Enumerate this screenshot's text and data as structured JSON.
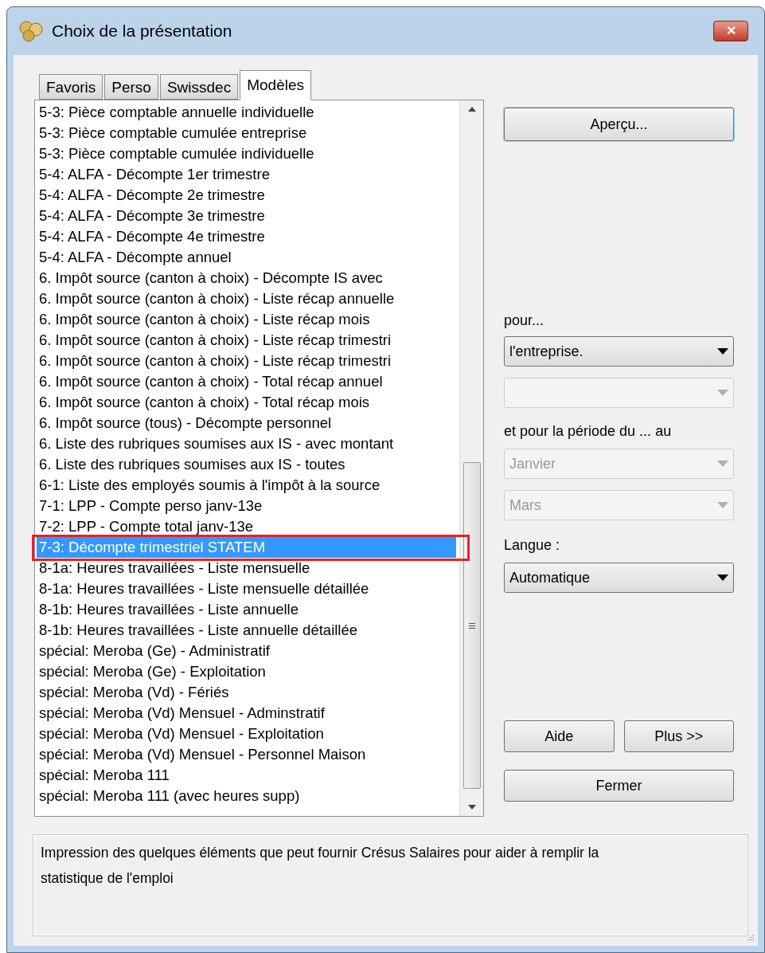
{
  "window": {
    "title": "Choix de la présentation",
    "close": "✕"
  },
  "tabs": [
    {
      "label": "Favoris",
      "selected": false
    },
    {
      "label": "Perso",
      "selected": false
    },
    {
      "label": "Swissdec",
      "selected": false
    },
    {
      "label": "Modèles",
      "selected": true
    }
  ],
  "list": {
    "items": [
      {
        "label": "5-3: Pièce comptable annuelle individuelle",
        "selected": false
      },
      {
        "label": "5-3: Pièce comptable cumulée entreprise",
        "selected": false
      },
      {
        "label": "5-3: Pièce comptable cumulée individuelle",
        "selected": false
      },
      {
        "label": "5-4: ALFA - Décompte 1er trimestre",
        "selected": false
      },
      {
        "label": "5-4: ALFA - Décompte 2e trimestre",
        "selected": false
      },
      {
        "label": "5-4: ALFA - Décompte 3e trimestre",
        "selected": false
      },
      {
        "label": "5-4: ALFA - Décompte 4e trimestre",
        "selected": false
      },
      {
        "label": "5-4: ALFA - Décompte annuel",
        "selected": false
      },
      {
        "label": "6. Impôt source (canton à choix) - Décompte IS avec",
        "selected": false
      },
      {
        "label": "6. Impôt source (canton à choix) - Liste récap annuelle",
        "selected": false
      },
      {
        "label": "6. Impôt source (canton à choix) - Liste récap mois",
        "selected": false
      },
      {
        "label": "6. Impôt source (canton à choix) - Liste récap trimestri",
        "selected": false
      },
      {
        "label": "6. Impôt source (canton à choix) - Liste récap trimestri",
        "selected": false
      },
      {
        "label": "6. Impôt source (canton à choix) - Total récap annuel",
        "selected": false
      },
      {
        "label": "6. Impôt source (canton à choix) - Total récap mois",
        "selected": false
      },
      {
        "label": "6. Impôt source (tous) - Décompte personnel",
        "selected": false
      },
      {
        "label": "6. Liste des rubriques soumises aux IS - avec montant",
        "selected": false
      },
      {
        "label": "6. Liste des rubriques soumises aux IS - toutes",
        "selected": false
      },
      {
        "label": "6-1: Liste des employés soumis à l'impôt à la source",
        "selected": false
      },
      {
        "label": "7-1: LPP - Compte perso janv-13e",
        "selected": false
      },
      {
        "label": "7-2: LPP - Compte total janv-13e",
        "selected": false
      },
      {
        "label": "7-3: Décompte trimestriel STATEM",
        "selected": true
      },
      {
        "label": "8-1a: Heures travaillées - Liste mensuelle",
        "selected": false
      },
      {
        "label": "8-1a: Heures travaillées - Liste mensuelle détaillée",
        "selected": false
      },
      {
        "label": "8-1b: Heures travaillées - Liste annuelle",
        "selected": false
      },
      {
        "label": "8-1b: Heures travaillées - Liste annuelle détaillée",
        "selected": false
      },
      {
        "label": "spécial: Meroba (Ge) - Administratif",
        "selected": false
      },
      {
        "label": "spécial: Meroba (Ge) - Exploitation",
        "selected": false
      },
      {
        "label": "spécial: Meroba (Vd) - Fériés",
        "selected": false
      },
      {
        "label": "spécial: Meroba (Vd) Mensuel - Adminstratif",
        "selected": false
      },
      {
        "label": "spécial: Meroba (Vd) Mensuel - Exploitation",
        "selected": false
      },
      {
        "label": "spécial: Meroba (Vd) Mensuel - Personnel Maison",
        "selected": false
      },
      {
        "label": "spécial: Meroba 111",
        "selected": false
      },
      {
        "label": "spécial: Meroba 111 (avec heures supp)",
        "selected": false
      }
    ]
  },
  "preview_button": "Aperçu...",
  "for_label": "pour...",
  "for_select": {
    "value": "l'entreprise.",
    "disabled": false
  },
  "for_select_2": {
    "disabled": true
  },
  "period_label": "et pour la période du ... au",
  "period_from": {
    "value": "Janvier",
    "disabled": true
  },
  "period_to": {
    "value": "Mars",
    "disabled": true
  },
  "language_label": "Langue :",
  "language_select": {
    "value": "Automatique",
    "disabled": false
  },
  "buttons": {
    "help": "Aide",
    "more": "Plus >>",
    "close": "Fermer"
  },
  "description": {
    "lines": [
      "Impression des quelques éléments que peut fournir Crésus Salaires pour aider à remplir la",
      "statistique de l'emploi"
    ]
  }
}
